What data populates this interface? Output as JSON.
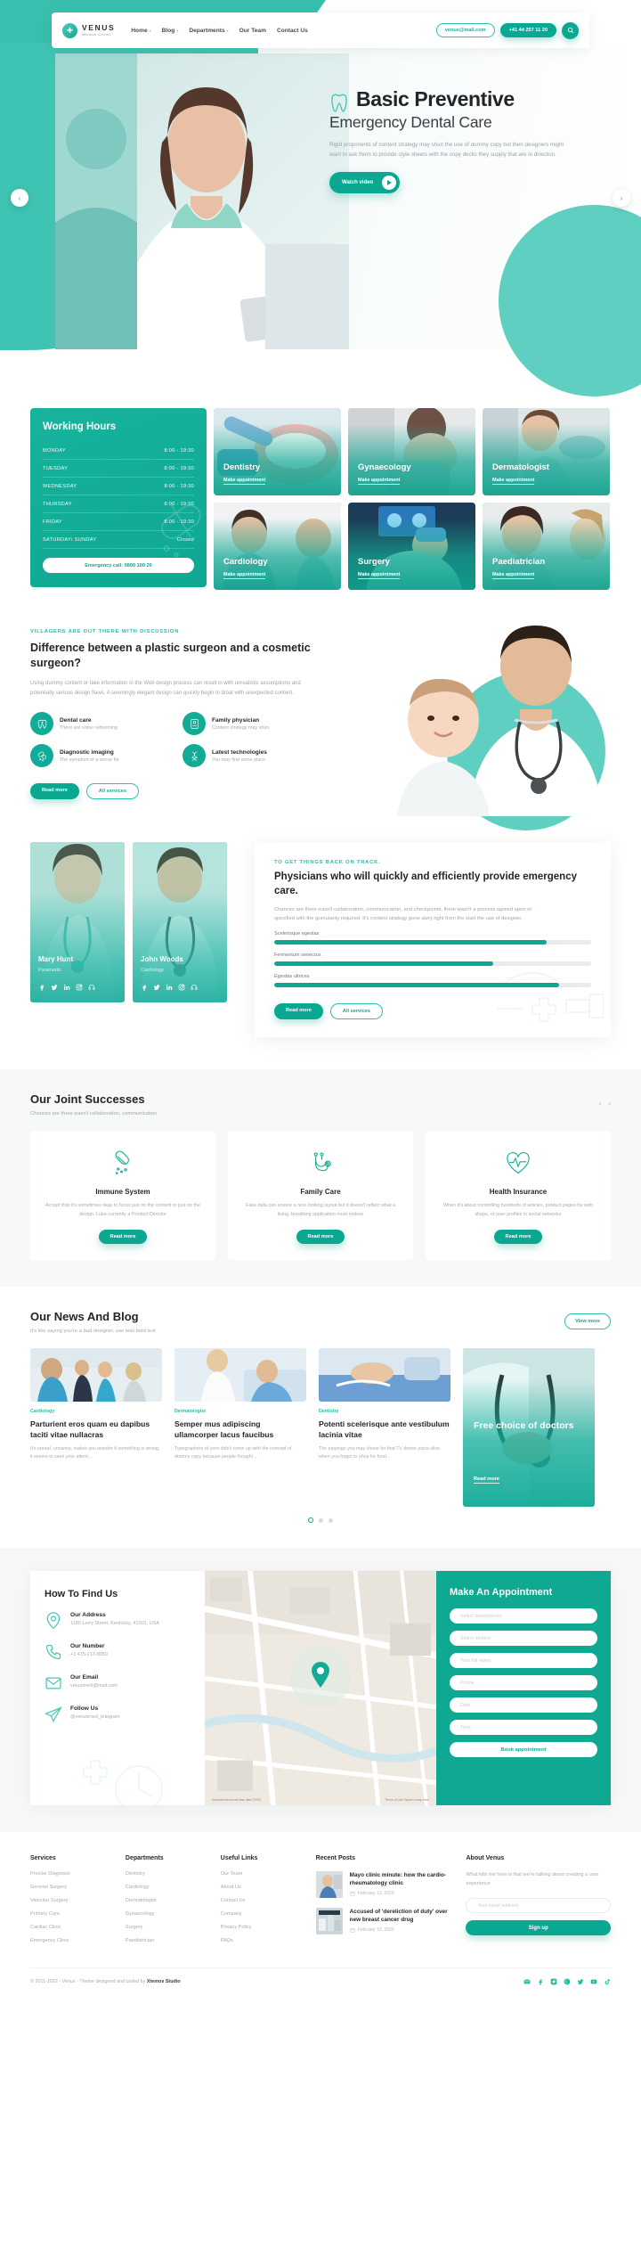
{
  "header": {
    "brand_name": "VENUS",
    "brand_sub": "Medical Center",
    "nav": [
      {
        "label": "Home",
        "caret": "▾"
      },
      {
        "label": "Blog",
        "caret": "▾"
      },
      {
        "label": "Departments",
        "caret": "▾"
      },
      {
        "label": "Our Team",
        "caret": ""
      },
      {
        "label": "Contact Us",
        "caret": ""
      }
    ],
    "email_pill": "venus@mail.com",
    "phone_pill": "+41 44 257 11 20",
    "search_icon": "search-icon"
  },
  "hero": {
    "title": "Basic Preventive",
    "subtitle": "Emergency Dental Care",
    "paragraph": "Rigid proponents of content strategy may shun the use of dummy copy but then designers might want to ask them to provide style sheets with the copy decks they supply that are in direction.",
    "watch_label": "Watch video",
    "arrow_left": "‹",
    "arrow_right": "›"
  },
  "working_hours": {
    "title": "Working Hours",
    "rows": [
      {
        "day": "MONDAY",
        "time": "8:00 - 19:30"
      },
      {
        "day": "TUESDAY",
        "time": "8:00 - 19:30"
      },
      {
        "day": "WEDNESDAY",
        "time": "8:00 - 19:30"
      },
      {
        "day": "THURSDAY",
        "time": "8:00 - 19:30"
      },
      {
        "day": "FRIDAY",
        "time": "8:00 - 19:30"
      },
      {
        "day": "SATURDAY/ SUNDAY",
        "time": "Closed"
      }
    ],
    "emergency": "Emergency call: 0800 100 20"
  },
  "services": {
    "cards": [
      {
        "label": "Dentistry",
        "cta": "Make appointment"
      },
      {
        "label": "Gynaecology",
        "cta": "Make appointment"
      },
      {
        "label": "Dermatologist",
        "cta": "Make appointment"
      },
      {
        "label": "Cardiology",
        "cta": "Make appointment"
      },
      {
        "label": "Surgery",
        "cta": "Make appointment"
      },
      {
        "label": "Paediatrician",
        "cta": "Make appointment"
      }
    ]
  },
  "difference": {
    "eyebrow": "VILLAGERS ARE OUT THERE WITH DISCUSSION",
    "title": "Difference between a plastic surgeon and a cosmetic surgeon?",
    "paragraph": "Using dummy content or fake information in the Web design process can result in with unrealistic assumptions and potentially serious design flaws. A seemingly elegant design can quickly begin to bloat with unexpected content.",
    "features": [
      {
        "title": "Dental care",
        "sub": "There are some redeeming",
        "icon": "tooth-icon"
      },
      {
        "title": "Family physician",
        "sub": "Content strategy may shun",
        "icon": "id-card-icon"
      },
      {
        "title": "Diagnostic imaging",
        "sub": "The symptom of a worse for",
        "icon": "pills-icon"
      },
      {
        "title": "Latest technologies",
        "sub": "You may find some place",
        "icon": "dna-icon"
      }
    ],
    "btn_primary": "Read more",
    "btn_secondary": "All services"
  },
  "doctors": [
    {
      "name": "Mary Hunt",
      "role": "Paramedic"
    },
    {
      "name": "John Woods",
      "role": "Cardiology"
    }
  ],
  "physicians": {
    "eyebrow": "TO GET THINGS BACK ON TRACK.",
    "title": "Physicians who will quickly and efficiently provide emergency care.",
    "paragraph": "Chances are there wasn't collaboration, communication, and checkpoints, there wasn't a process agreed upon or specified with the granularity required. It's content strategy gone awry right from the start the use of designer.",
    "bars": [
      {
        "label": "Scelerisque egestas",
        "value": 86
      },
      {
        "label": "Fermentum senectus",
        "value": 69
      },
      {
        "label": "Egestas ultrices",
        "value": 90
      }
    ],
    "btn_primary": "Read more",
    "btn_secondary": "All services"
  },
  "successes": {
    "title": "Our Joint Successes",
    "subtitle": "Chances are there wasn't collaboration, communication",
    "prev": "‹",
    "next": "›",
    "cards": [
      {
        "icon": "capsule-pills-icon",
        "title": "Immune System",
        "text": "Accept that it's sometimes okay to focus just on the content or just on the design. Luke currently a Product Director",
        "btn": "Read more"
      },
      {
        "icon": "stethoscope-icon",
        "title": "Family Care",
        "text": "Fake data can ensure a nice looking layout but it doesn't reflect what a living, breathing application must endure",
        "btn": "Read more"
      },
      {
        "icon": "heart-pulse-icon",
        "title": "Health Insurance",
        "text": "When it's about controlling hundreds of articles, product pages for web shops, or user profiles in social networks",
        "btn": "Read more"
      }
    ]
  },
  "blog": {
    "title": "Our News And Blog",
    "subtitle": "It's like saying you're a bad designer, use less bold text",
    "view_more": "View more",
    "posts": [
      {
        "category": "Cardiology",
        "title": "Parturient eros quam eu dapibus taciti vitae nullacras",
        "excerpt": "It's unreal, uncanny, makes you wonder if something is wrong, it seems to seek your attent..."
      },
      {
        "category": "Dermatologist",
        "title": "Semper mus adipiscing ullamcorper lacus faucibus",
        "excerpt": "Typographers of yore didn't come up with the concept of dummy copy because people thought ..."
      },
      {
        "category": "Dentistry",
        "title": "Potenti scelerisque ante vestibulum lacinia vitae",
        "excerpt": "The toppings you may chose for that TV dinner pizza slice when you forgot to shop for food..."
      }
    ],
    "promo": {
      "title": "Free choice of doctors",
      "link": "Read more"
    }
  },
  "find_us": {
    "title": "How To Find Us",
    "items": [
      {
        "icon": "location-pin-icon",
        "title": "Our Address",
        "value": "1180 Larry Street, Kentucky, 41001, USA"
      },
      {
        "icon": "phone-icon",
        "title": "Our Number",
        "value": "+1 415-213-8050"
      },
      {
        "icon": "envelope-icon",
        "title": "Our Email",
        "value": "venusmed@mail.com"
      },
      {
        "icon": "paper-plane-icon",
        "title": "Follow Us",
        "value": "@venusmed_telegram"
      }
    ],
    "map_credit_left": "Keyboard shortcuts  Map data ©2020",
    "map_credit_right": "Terms of Use  Report a map error"
  },
  "appointment": {
    "title": "Make An Appointment",
    "fields": [
      {
        "placeholder": "Select departments",
        "name": "department-select"
      },
      {
        "placeholder": "Select doctors",
        "name": "doctor-select"
      },
      {
        "placeholder": "Your full name",
        "name": "fullname-input"
      },
      {
        "placeholder": "Phone",
        "name": "phone-input"
      },
      {
        "placeholder": "Date",
        "name": "date-input"
      },
      {
        "placeholder": "Time",
        "name": "time-input"
      }
    ],
    "button": "Book appointment"
  },
  "footer": {
    "columns": [
      {
        "title": "Services",
        "links": [
          "Precise Diagnosis",
          "General Surgery",
          "Vascular Surgery",
          "Primary Care",
          "Cardiac Clinic",
          "Emergency Clinic"
        ]
      },
      {
        "title": "Departments",
        "links": [
          "Dentistry",
          "Cardiology",
          "Dermatologist",
          "Gynaecology",
          "Surgery",
          "Paediatrician"
        ]
      },
      {
        "title": "Useful Links",
        "links": [
          "Our Team",
          "About Us",
          "Contact Us",
          "Company",
          "Privacy Policy",
          "FAQs"
        ]
      }
    ],
    "recent_posts_title": "Recent Posts",
    "recent_posts": [
      {
        "title": "Mayo clinic minute: how the cardio-rheumatology clinic",
        "date": "February 13, 2020"
      },
      {
        "title": "Accused of 'dereliction of duty' over new breast cancer drug",
        "date": "February 13, 2020"
      }
    ],
    "about_title": "About Venus",
    "about_text": "What kills me here is that we're talking about creating  a user experience",
    "email_placeholder": "Your email address",
    "signup": "Sign up",
    "copyright_pre": "© 2011-2022 - Venus - Theme designed and coded by ",
    "copyright_brand": "Xtemos Studio",
    "copyright_post": ".",
    "social": [
      "envelope-icon",
      "facebook-icon",
      "instagram-icon",
      "pinterest-icon",
      "twitter-icon",
      "youtube-icon",
      "tiktok-icon"
    ]
  },
  "colors": {
    "accent": "#0aa791",
    "accent_light": "#3fc3b2",
    "teal_blob": "#5ecfc0",
    "dark_text": "#23242a",
    "muted_text": "#a6abb1"
  }
}
